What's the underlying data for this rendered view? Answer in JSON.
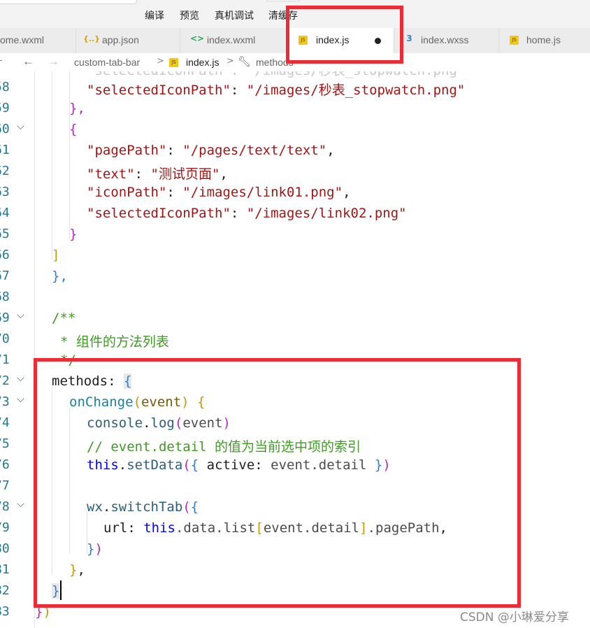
{
  "toolbar": {
    "search_value": "✓",
    "actions": [
      "编译",
      "预览",
      "真机调试",
      "清缓存"
    ]
  },
  "tabs": [
    {
      "label": "ome.wxml",
      "icon": "wxml-file-icon",
      "icon_glyph": "</>"
    },
    {
      "label": "app.json",
      "icon": "json-file-icon",
      "icon_glyph": "{..}"
    },
    {
      "label": "index.wxml",
      "icon": "wxml-file-icon",
      "icon_glyph": "<>"
    },
    {
      "label": "index.js",
      "icon": "js-file-icon",
      "icon_glyph": "JS",
      "active": true,
      "unsaved": true
    },
    {
      "label": "index.wxss",
      "icon": "css-file-icon",
      "icon_glyph": "3"
    },
    {
      "label": "home.js",
      "icon": "js-file-icon",
      "icon_glyph": "JS"
    }
  ],
  "breadcrumb": {
    "items": [
      "custom-tab-bar",
      "index.js",
      "methods"
    ],
    "back_glyph": "←",
    "forward_glyph": "→",
    "sep": ">"
  },
  "editor": {
    "line_numbers": [
      "58",
      "59",
      "60",
      "61",
      "62",
      "63",
      "64",
      "65",
      "66",
      "67",
      "68",
      "69",
      "70",
      "71",
      "72",
      "73",
      "74",
      "75",
      "76",
      "77",
      "78",
      "79",
      "80",
      "81",
      "82",
      "83"
    ],
    "code": {
      "l57_partial": "\"selectedIconPath\": \"/images/秒表_stopwatch.png\"",
      "l58_key": "\"selectedIconPath\"",
      "l58_val": "\"/images/秒表_stopwatch.png\"",
      "l59": "},",
      "l60": "{",
      "l61_key": "\"pagePath\"",
      "l61_val": "\"/pages/text/text\"",
      "l62_key": "\"text\"",
      "l62_val": "\"测试页面\"",
      "l63_key": "\"iconPath\"",
      "l63_val": "\"/images/link01.png\"",
      "l64_key": "\"selectedIconPath\"",
      "l64_val": "\"/images/link02.png\"",
      "l65": "}",
      "l66": "]",
      "l67": "},",
      "l69": "/**",
      "l70": "* 组件的方法列表",
      "l71": "*/",
      "l72_name": "methods",
      "l73_fn": "onChange",
      "l73_arg": "event",
      "l74_obj": "console",
      "l74_fn": "log",
      "l74_arg": "event",
      "l75": "// event.detail 的值为当前选中项的索引",
      "l76_this": "this",
      "l76_fn": "setData",
      "l76_key": "active",
      "l76_val": "event.detail",
      "l78_obj": "wx",
      "l78_fn": "switchTab",
      "l79_key": "url",
      "l79_this": "this",
      "l79_path1": ".data.list",
      "l79_idx": "event.detail",
      "l79_path2": ".pagePath",
      "l80": "})",
      "l81": "},",
      "l82": "}",
      "l83": "})"
    }
  },
  "watermark": "CSDN @小琳爱分享",
  "colors": {
    "annotation_red": "#ec2b35",
    "string": "#a31515",
    "comment": "#3f9a24",
    "keyword": "#0000ff"
  }
}
